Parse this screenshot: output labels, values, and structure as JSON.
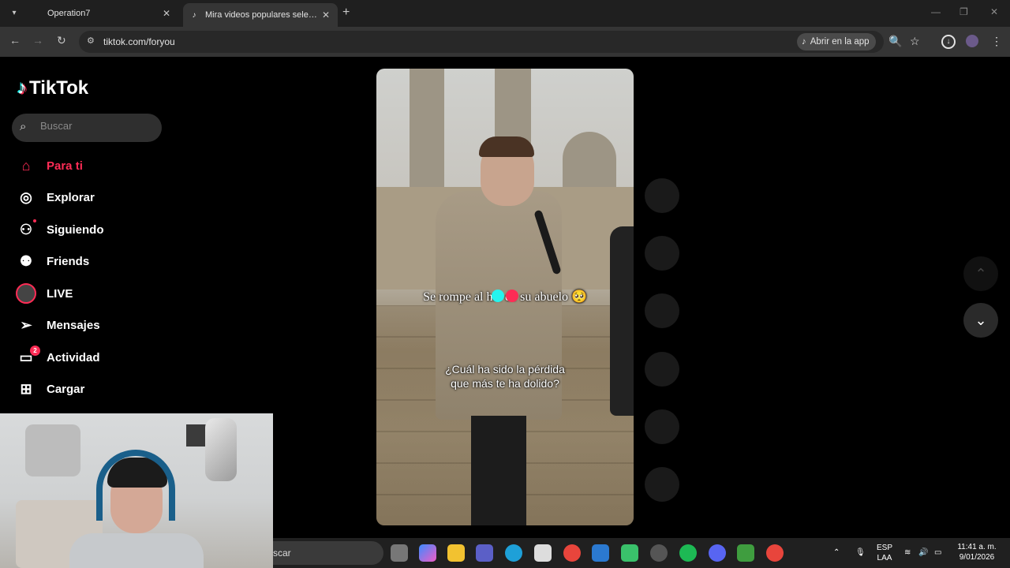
{
  "browser": {
    "tabs": [
      {
        "title": "Operation7",
        "active": false
      },
      {
        "title": "Mira videos populares seleccionados para ti | TikTok",
        "active": true
      }
    ],
    "new_tab": "+",
    "window_controls": {
      "minimize": "—",
      "maximize": "❐",
      "close": "✕"
    },
    "url": "tiktok.com/foryou",
    "open_in_app": "Abrir en la app"
  },
  "tiktok": {
    "logo_text": "TikTok",
    "search_placeholder": "Buscar",
    "nav": [
      {
        "label": "Para ti",
        "icon": "home-icon",
        "active": true
      },
      {
        "label": "Explorar",
        "icon": "compass-icon"
      },
      {
        "label": "Siguiendo",
        "icon": "following-icon"
      },
      {
        "label": "Friends",
        "icon": "friends-icon"
      },
      {
        "label": "LIVE",
        "icon": "live-icon"
      },
      {
        "label": "Mensajes",
        "icon": "messages-icon"
      },
      {
        "label": "Actividad",
        "icon": "activity-icon",
        "badge": "2"
      },
      {
        "label": "Cargar",
        "icon": "upload-icon"
      }
    ],
    "video": {
      "caption_top": "Se rompe al hal   de su abuelo 🥺",
      "caption_bottom": "¿Cuál ha sido la pérdida\nque más te ha dolido?"
    },
    "accent_colors": {
      "pink": "#fe2c55",
      "cyan": "#25f4ee"
    }
  },
  "taskbar": {
    "search_text": "scar",
    "language": "ESP",
    "layout": "LAA",
    "time": "11:41 a. m.",
    "date": "9/01/2026"
  }
}
